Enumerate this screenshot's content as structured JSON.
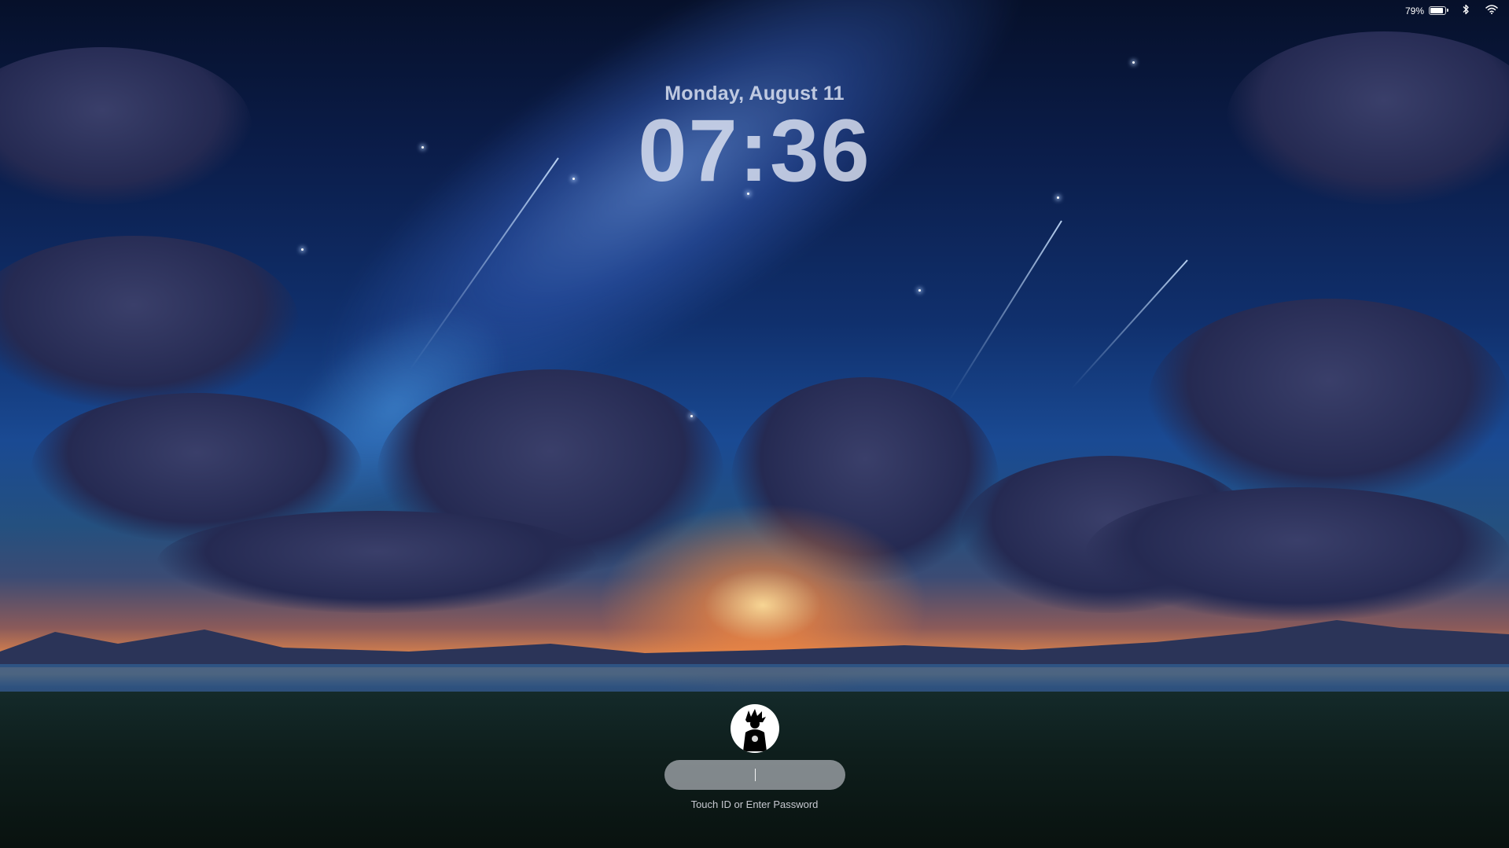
{
  "status_bar": {
    "battery_percent": "79%",
    "battery_level": 0.79,
    "icons": [
      "battery-icon",
      "bluetooth-icon",
      "wifi-icon"
    ]
  },
  "lock_screen": {
    "date": "Monday, August 11",
    "time": "07:36"
  },
  "login": {
    "avatar_icon": "user-avatar-silhouette",
    "password_placeholder": "",
    "hint": "Touch ID or Enter Password"
  },
  "colors": {
    "text": "#e2e7f5",
    "field_bg": "#e1e1eb"
  }
}
